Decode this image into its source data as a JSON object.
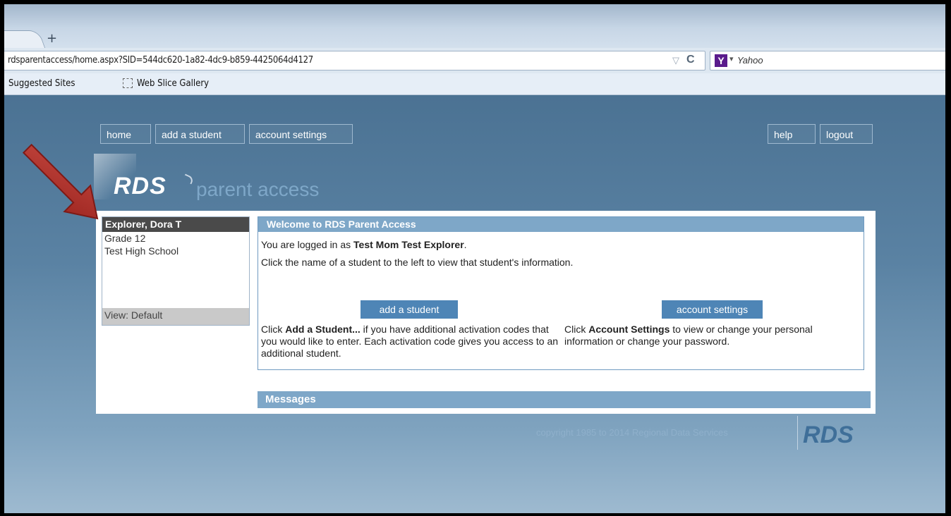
{
  "browser": {
    "new_tab_glyph": "+",
    "url": "rdsparentaccess/home.aspx?SID=544dc620-1a82-4dc9-b859-4425064d4127",
    "search_engine": "Yahoo",
    "search_badge": "Y",
    "bookmarks": [
      "Suggested Sites",
      "Web Slice Gallery"
    ]
  },
  "nav": {
    "home": "home",
    "add_student": "add a student",
    "account_settings": "account settings",
    "help": "help",
    "logout": "logout"
  },
  "logo": {
    "brand": "RDS",
    "tagline": "parent access"
  },
  "student": {
    "name": "Explorer, Dora T",
    "grade": "Grade 12",
    "school": "Test High School",
    "view": "View: Default"
  },
  "welcome": {
    "title": "Welcome to RDS Parent Access",
    "logged_in_prefix": "You are logged in as ",
    "logged_in_user": "Test Mom Test Explorer",
    "logged_in_suffix": ".",
    "instruction": "Click the name of a student to the left to view that student's information.",
    "add_button": "add a student",
    "account_button": "account settings",
    "add_desc_prefix": "Click ",
    "add_desc_bold": "Add a Student...",
    "add_desc_rest": " if you have additional activation codes that you would like to enter. Each activation code gives you access to an additional student.",
    "account_desc_prefix": "Click ",
    "account_desc_bold": "Account Settings",
    "account_desc_rest": " to view or change your personal information or change your password."
  },
  "messages": {
    "title": "Messages"
  },
  "footer": {
    "copyright": "copyright 1985 to 2014 Regional Data Services",
    "logo": "RDS"
  },
  "colors": {
    "header_blue": "#7ea7c8",
    "button_blue": "#4e85b6",
    "student_header": "#4a4a4a",
    "arrow_red": "#b2302a"
  }
}
